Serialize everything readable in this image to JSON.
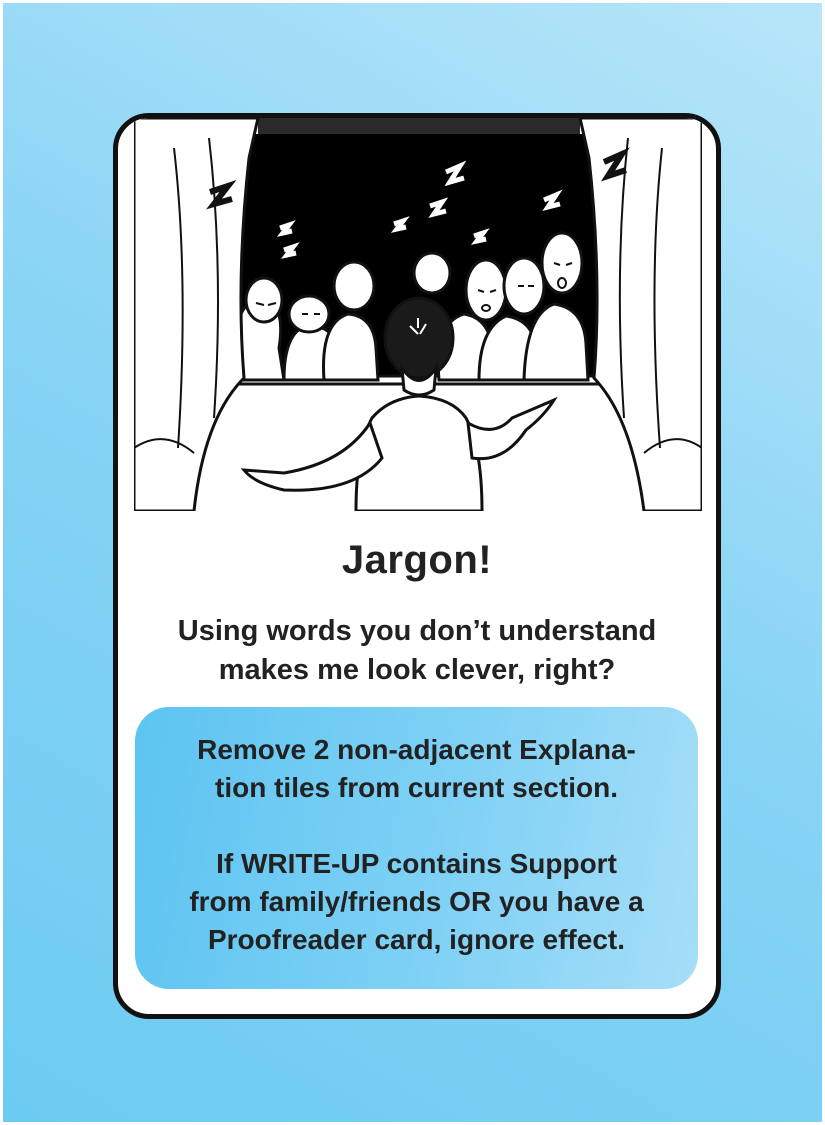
{
  "card": {
    "title": "Jargon!",
    "flavor": {
      "line1": "Using words you don’t understand",
      "line2": "makes me look clever, right?"
    },
    "effect": {
      "line1": "Remove 2 non-adjacent Explana-",
      "line2": "tion tiles from current section.",
      "line3": "If WRITE-UP contains Support",
      "line4": "from family/friends OR you have a",
      "line5": "Proofreader card, ignore effect."
    },
    "illustration": {
      "icons": [
        "stage-curtain-left-icon",
        "stage-curtain-right-icon",
        "sleeping-audience-icon",
        "presenter-icon",
        "sleep-z-icon"
      ]
    }
  },
  "colors": {
    "background_light": "#b8e6f9",
    "background_dark": "#6ccbf2",
    "effect_box": "#7fd1f5",
    "text": "#222222",
    "frame": "#111111"
  }
}
